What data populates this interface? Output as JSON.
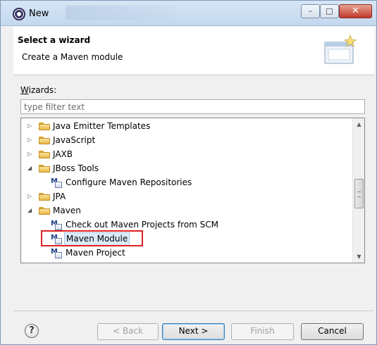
{
  "window": {
    "title": "New",
    "minimize_glyph": "–",
    "maximize_glyph": "□",
    "close_glyph": "✕"
  },
  "header": {
    "title": "Select a wizard",
    "description": "Create a Maven module"
  },
  "wizards": {
    "label": "Wizards:",
    "label_mnemonic": "W",
    "label_rest": "izards:",
    "filter_placeholder": "type filter text",
    "filter_value": ""
  },
  "tree": {
    "items": [
      {
        "label": "Java Emitter Templates",
        "type": "folder",
        "expanded": false,
        "depth": 0
      },
      {
        "label": "JavaScript",
        "type": "folder",
        "expanded": false,
        "depth": 0
      },
      {
        "label": "JAXB",
        "type": "folder",
        "expanded": false,
        "depth": 0
      },
      {
        "label": "JBoss Tools",
        "type": "folder",
        "expanded": true,
        "depth": 0
      },
      {
        "label": "Configure Maven Repositories",
        "type": "maven-item",
        "depth": 1
      },
      {
        "label": "JPA",
        "type": "folder",
        "expanded": false,
        "depth": 0
      },
      {
        "label": "Maven",
        "type": "folder",
        "expanded": true,
        "depth": 0
      },
      {
        "label": "Check out Maven Projects from SCM",
        "type": "maven-item",
        "depth": 1
      },
      {
        "label": "Maven Module",
        "type": "maven-item",
        "depth": 1,
        "selected": true,
        "highlighted": true
      },
      {
        "label": "Maven Project",
        "type": "maven-item",
        "depth": 1
      }
    ],
    "scroll_position": 0.55
  },
  "buttons": {
    "help": "?",
    "back": "< Back",
    "next": "Next >",
    "finish": "Finish",
    "cancel": "Cancel"
  },
  "colors": {
    "highlight_box": "#e02020",
    "folder": "#e9b749",
    "selection": "#dbeaf9"
  }
}
